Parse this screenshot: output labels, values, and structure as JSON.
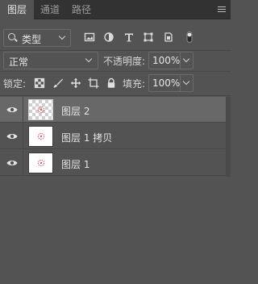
{
  "tabs": [
    {
      "label": "图层",
      "active": true
    },
    {
      "label": "通道",
      "active": false
    },
    {
      "label": "路径",
      "active": false
    }
  ],
  "filter": {
    "kind_label": "类型",
    "icons": [
      "image-filter-icon",
      "adjustment-filter-icon",
      "type-filter-icon",
      "shape-filter-icon",
      "smart-object-filter-icon",
      "filter-toggle-icon"
    ]
  },
  "blend": {
    "mode": "正常",
    "opacity_label": "不透明度:",
    "opacity_value": "100%"
  },
  "lock": {
    "label": "锁定:",
    "fill_label": "填充:",
    "fill_value": "100%",
    "icons": [
      "lock-transparent-pixels-icon",
      "lock-image-pixels-icon",
      "lock-position-icon",
      "lock-artboard-icon",
      "lock-all-icon"
    ]
  },
  "layers": [
    {
      "name": "图层 2",
      "selected": true,
      "visible": true
    },
    {
      "name": "图层 1 拷贝",
      "selected": false,
      "visible": true
    },
    {
      "name": "图层 1",
      "selected": false,
      "visible": true
    }
  ],
  "colors": {
    "panel_bg": "#535353",
    "tab_bar_bg": "#323232",
    "selected_layer_bg": "#686868",
    "thumb_mark": "#d65a6a"
  }
}
